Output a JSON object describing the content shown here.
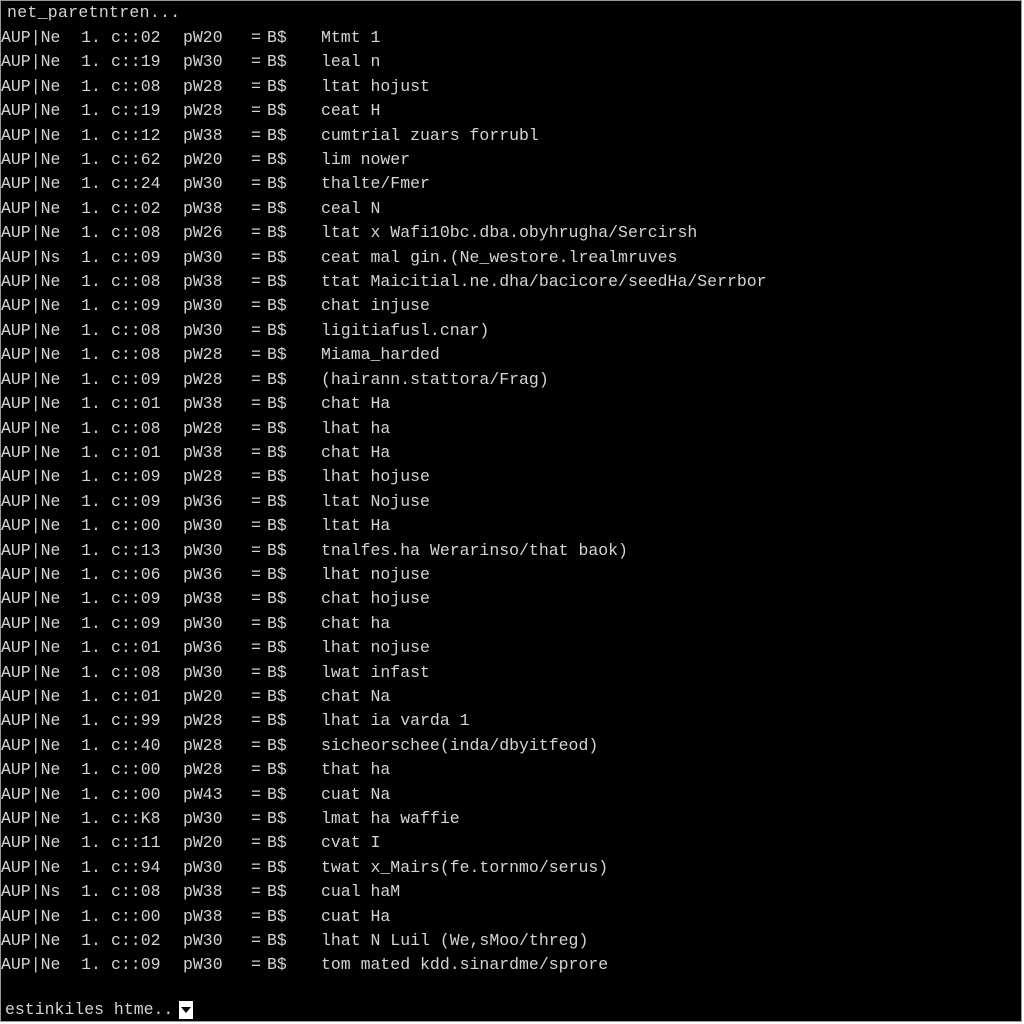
{
  "header": {
    "title": "net_paretntren..."
  },
  "columns": {
    "tag": "AUP",
    "sep": "|",
    "num": "1.",
    "eq": "=",
    "bflag": "B$"
  },
  "rows": [
    {
      "ne": "Ne",
      "cc": "c::02",
      "pw": "pW20",
      "desc": "Mtmt 1"
    },
    {
      "ne": "Ne",
      "cc": "c::19",
      "pw": "pW30",
      "desc": "leal n"
    },
    {
      "ne": "Ne",
      "cc": "c::08",
      "pw": "pW28",
      "desc": "ltat hojust"
    },
    {
      "ne": "Ne",
      "cc": "c::19",
      "pw": "pW28",
      "desc": "ceat H"
    },
    {
      "ne": "Ne",
      "cc": "c::12",
      "pw": "pW38",
      "desc": "cumtrial zuars forrubl"
    },
    {
      "ne": "Ne",
      "cc": "c::62",
      "pw": "pW20",
      "desc": "lim nower"
    },
    {
      "ne": "Ne",
      "cc": "c::24",
      "pw": "pW30",
      "desc": "thalte/Fmer"
    },
    {
      "ne": "Ne",
      "cc": "c::02",
      "pw": "pW38",
      "desc": "ceal N"
    },
    {
      "ne": "Ne",
      "cc": "c::08",
      "pw": "pW26",
      "desc": "ltat x Wafi10bc.dba.obyhrugha/Sercirsh"
    },
    {
      "ne": "Ns",
      "cc": "c::09",
      "pw": "pW30",
      "desc": "ceat mal gin.(Ne_westore.lrealmruves"
    },
    {
      "ne": "Ne",
      "cc": "c::08",
      "pw": "pW38",
      "desc": "ttat Maicitial.ne.dha/bacicore/seedHa/Serrbor"
    },
    {
      "ne": "Ne",
      "cc": "c::09",
      "pw": "pW30",
      "desc": "chat injuse"
    },
    {
      "ne": "Ne",
      "cc": "c::08",
      "pw": "pW30",
      "desc": "ligitiafusl.cnar)"
    },
    {
      "ne": "Ne",
      "cc": "c::08",
      "pw": "pW28",
      "desc": "Miama_harded"
    },
    {
      "ne": "Ne",
      "cc": "c::09",
      "pw": "pW28",
      "desc": "(hairann.stattora/Frag)"
    },
    {
      "ne": "Ne",
      "cc": "c::01",
      "pw": "pW38",
      "desc": "chat Ha"
    },
    {
      "ne": "Ne",
      "cc": "c::08",
      "pw": "pW28",
      "desc": "lhat ha"
    },
    {
      "ne": "Ne",
      "cc": "c::01",
      "pw": "pW38",
      "desc": "chat Ha"
    },
    {
      "ne": "Ne",
      "cc": "c::09",
      "pw": "pW28",
      "desc": "lhat hojuse"
    },
    {
      "ne": "Ne",
      "cc": "c::09",
      "pw": "pW36",
      "desc": "ltat Nojuse"
    },
    {
      "ne": "Ne",
      "cc": "c::00",
      "pw": "pW30",
      "desc": "ltat Ha"
    },
    {
      "ne": "Ne",
      "cc": "c::13",
      "pw": "pW30",
      "desc": "tnalfes.ha Werarinso/that baok)"
    },
    {
      "ne": "Ne",
      "cc": "c::06",
      "pw": "pW36",
      "desc": "lhat nojuse"
    },
    {
      "ne": "Ne",
      "cc": "c::09",
      "pw": "pW38",
      "desc": "chat hojuse"
    },
    {
      "ne": "Ne",
      "cc": "c::09",
      "pw": "pW30",
      "desc": "chat ha"
    },
    {
      "ne": "Ne",
      "cc": "c::01",
      "pw": "pW36",
      "desc": "lhat nojuse"
    },
    {
      "ne": "Ne",
      "cc": "c::08",
      "pw": "pW30",
      "desc": "lwat infast"
    },
    {
      "ne": "Ne",
      "cc": "c::01",
      "pw": "pW20",
      "desc": "chat Na"
    },
    {
      "ne": "Ne",
      "cc": "c::99",
      "pw": "pW28",
      "desc": "lhat ia varda 1"
    },
    {
      "ne": "Ne",
      "cc": "c::40",
      "pw": "pW28",
      "desc": "sicheorschee(inda/dbyitfeod)"
    },
    {
      "ne": "Ne",
      "cc": "c::00",
      "pw": "pW28",
      "desc": "that ha"
    },
    {
      "ne": "Ne",
      "cc": "c::00",
      "pw": "pW43",
      "desc": "cuat Na"
    },
    {
      "ne": "Ne",
      "cc": "c::K8",
      "pw": "pW30",
      "desc": "lmat ha waffie"
    },
    {
      "ne": "Ne",
      "cc": "c::11",
      "pw": "pW20",
      "desc": "cvat I"
    },
    {
      "ne": "Ne",
      "cc": "c::94",
      "pw": "pW30",
      "desc": "twat x_Mairs(fe.tornmo/serus)"
    },
    {
      "ne": "Ns",
      "cc": "c::08",
      "pw": "pW38",
      "desc": "cual haM"
    },
    {
      "ne": "Ne",
      "cc": "c::00",
      "pw": "pW38",
      "desc": "cuat Ha"
    },
    {
      "ne": "Ne",
      "cc": "c::02",
      "pw": "pW30",
      "desc": "lhat N Luil (We,sMoo/threg)"
    },
    {
      "ne": "Ne",
      "cc": "c::09",
      "pw": "pW30",
      "desc": "tom mated kdd.sinardme/sprore"
    }
  ],
  "prompt": {
    "text": "estinkiles htme.."
  }
}
